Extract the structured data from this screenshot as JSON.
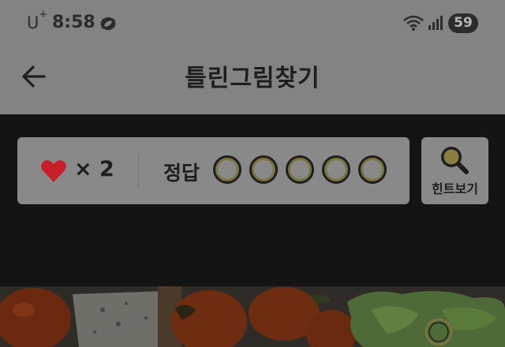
{
  "status_bar": {
    "carrier": "U",
    "carrier_sup": "+",
    "time": "8:58",
    "battery": "59",
    "icons": [
      "swirl-icon",
      "wifi-icon",
      "signal-icon"
    ]
  },
  "app_bar": {
    "title": "틀린그림찾기",
    "back_icon": "back-arrow-icon"
  },
  "game": {
    "lives_icon": "heart-icon",
    "lives_text": "× 2",
    "lives_count": 2,
    "answer_label": "정답",
    "answer_slots": 5,
    "answers_found": 0,
    "hint_label": "힌트보기",
    "hint_icon": "magnifier-icon"
  },
  "colors": {
    "heart": "#c8202a",
    "slot_ring": "#7a7540",
    "overlay_bg": "#838383",
    "dark_bg": "#141414"
  }
}
